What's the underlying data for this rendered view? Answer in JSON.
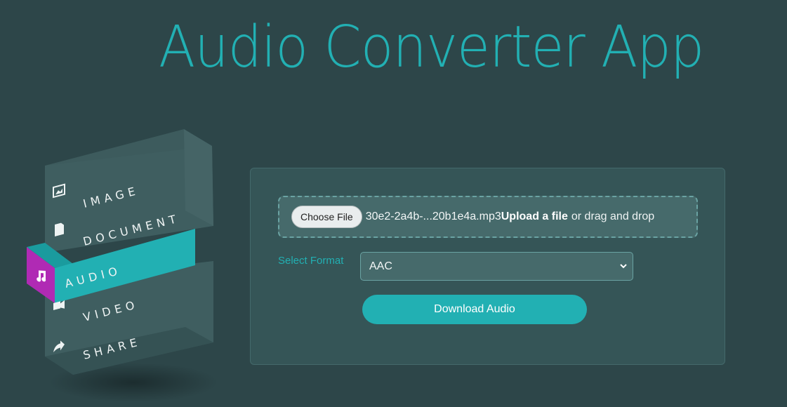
{
  "app": {
    "title": "Audio Converter App"
  },
  "menu": {
    "items": [
      {
        "label": "IMAGE",
        "icon": "image-icon",
        "active": false
      },
      {
        "label": "DOCUMENT",
        "icon": "document-icon",
        "active": false
      },
      {
        "label": "AUDIO",
        "icon": "music-note-icon",
        "active": true
      },
      {
        "label": "VIDEO",
        "icon": "video-icon",
        "active": false
      },
      {
        "label": "SHARE",
        "icon": "share-icon",
        "active": false
      }
    ],
    "active_color": "#b02ab4",
    "accent_color": "#22b0b3"
  },
  "upload": {
    "choose_label": "Choose File",
    "file_name": "30e2-2a4b-...20b1e4a.mp3",
    "upload_strong": "Upload a file",
    "upload_rest": "or drag and drop"
  },
  "format": {
    "label": "Select Format",
    "selected": "AAC"
  },
  "actions": {
    "download_label": "Download Audio"
  },
  "colors": {
    "background": "#2d4649",
    "accent": "#22b0b3",
    "panel": "#355557"
  }
}
